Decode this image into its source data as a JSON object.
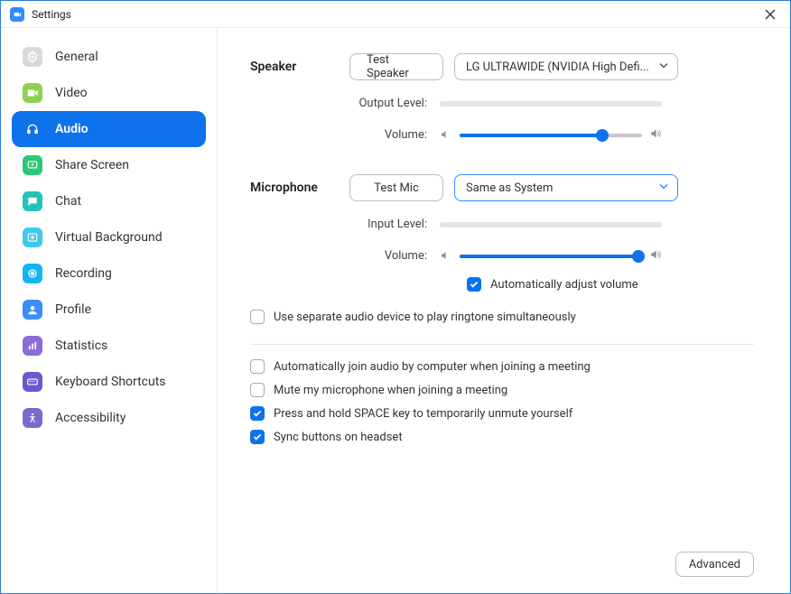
{
  "window": {
    "title": "Settings"
  },
  "sidebar": {
    "items": [
      {
        "label": "General"
      },
      {
        "label": "Video"
      },
      {
        "label": "Audio"
      },
      {
        "label": "Share Screen"
      },
      {
        "label": "Chat"
      },
      {
        "label": "Virtual Background"
      },
      {
        "label": "Recording"
      },
      {
        "label": "Profile"
      },
      {
        "label": "Statistics"
      },
      {
        "label": "Keyboard Shortcuts"
      },
      {
        "label": "Accessibility"
      }
    ]
  },
  "audio": {
    "speaker": {
      "label": "Speaker",
      "test_button": "Test Speaker",
      "device": "LG ULTRAWIDE (NVIDIA High Defi...",
      "output_level_label": "Output Level:",
      "volume_label": "Volume:",
      "volume_percent": 78
    },
    "microphone": {
      "label": "Microphone",
      "test_button": "Test Mic",
      "device": "Same as System",
      "input_level_label": "Input Level:",
      "volume_label": "Volume:",
      "volume_percent": 98,
      "auto_adjust_label": "Automatically adjust volume",
      "auto_adjust_checked": true
    },
    "options": {
      "separate_ringtone_label": "Use separate audio device to play ringtone simultaneously",
      "separate_ringtone_checked": false,
      "auto_join_label": "Automatically join audio by computer when joining a meeting",
      "auto_join_checked": false,
      "mute_on_join_label": "Mute my microphone when joining a meeting",
      "mute_on_join_checked": false,
      "space_unmute_label": "Press and hold SPACE key to temporarily unmute yourself",
      "space_unmute_checked": true,
      "sync_headset_label": "Sync buttons on headset",
      "sync_headset_checked": true
    },
    "advanced_button": "Advanced"
  }
}
